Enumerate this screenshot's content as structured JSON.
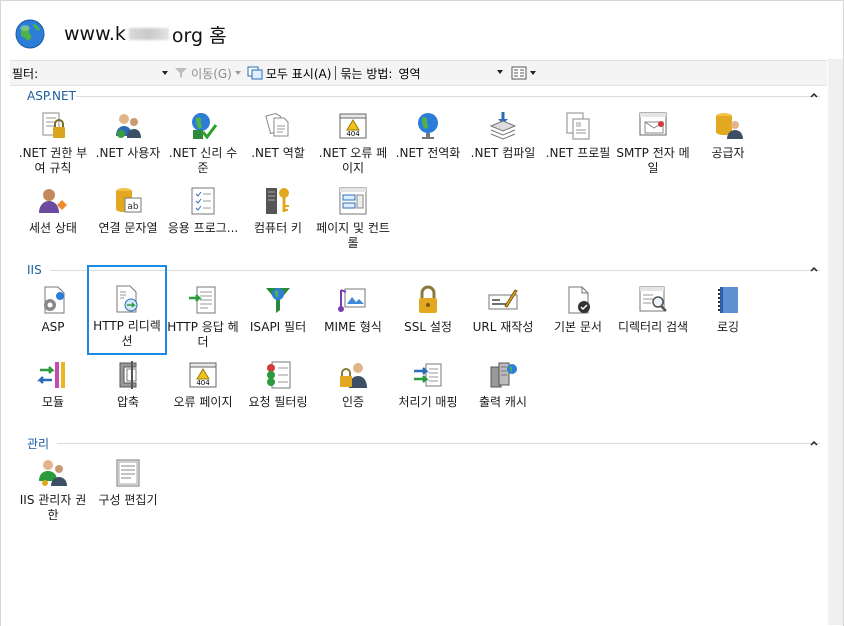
{
  "header": {
    "title_prefix": "www.k",
    "title_suffix": "org 홈",
    "icon": "globe-icon"
  },
  "toolbar": {
    "filter_label": "필터:",
    "filter_value": "",
    "go_label": "이동(G)",
    "show_all_label": "모두 표시(A)",
    "group_by_label": "묶는 방법:",
    "group_by_value": "영역",
    "view_icon": "view-grid-icon"
  },
  "sections": [
    {
      "name": "ASP.NET",
      "items": [
        {
          "label": ".NET 권한 부여 규칙",
          "icon": "lock-doc-icon"
        },
        {
          "label": ".NET 사용자",
          "icon": "users-icon"
        },
        {
          "label": ".NET 신리 수준",
          "icon": "trust-icon"
        },
        {
          "label": ".NET 역할",
          "icon": "roles-icon"
        },
        {
          "label": ".NET 오류 페이지",
          "icon": "error-404-icon"
        },
        {
          "label": ".NET 전역화",
          "icon": "globe-icon"
        },
        {
          "label": ".NET 컴파일",
          "icon": "compile-icon"
        },
        {
          "label": ".NET 프로필",
          "icon": "profile-icon"
        },
        {
          "label": "SMTP 전자 메일",
          "icon": "email-icon"
        },
        {
          "label": "공급자",
          "icon": "provider-icon"
        },
        {
          "label": "세션 상태",
          "icon": "session-icon"
        },
        {
          "label": "연결 문자열",
          "icon": "database-icon"
        },
        {
          "label": "응용 프로그...",
          "icon": "app-settings-icon"
        },
        {
          "label": "컴퓨터 키",
          "icon": "machine-key-icon"
        },
        {
          "label": "페이지 및 컨트롤",
          "icon": "pages-controls-icon"
        }
      ]
    },
    {
      "name": "IIS",
      "items": [
        {
          "label": "ASP",
          "icon": "asp-icon"
        },
        {
          "label": "HTTP 리디렉션",
          "icon": "redirect-icon",
          "selected": true
        },
        {
          "label": "HTTP 응답 헤더",
          "icon": "response-headers-icon"
        },
        {
          "label": "ISAPI 필터",
          "icon": "isapi-filter-icon"
        },
        {
          "label": "MIME 형식",
          "icon": "mime-icon"
        },
        {
          "label": "SSL 설정",
          "icon": "ssl-lock-icon"
        },
        {
          "label": "URL 재작성",
          "icon": "url-rewrite-icon"
        },
        {
          "label": "기본 문서",
          "icon": "default-doc-icon"
        },
        {
          "label": "디렉터리 검색",
          "icon": "dir-browse-icon"
        },
        {
          "label": "로깅",
          "icon": "logging-icon"
        },
        {
          "label": "모듈",
          "icon": "modules-icon"
        },
        {
          "label": "압축",
          "icon": "compression-icon"
        },
        {
          "label": "오류 페이지",
          "icon": "error-pages-icon"
        },
        {
          "label": "요청 필터링",
          "icon": "request-filter-icon"
        },
        {
          "label": "인증",
          "icon": "auth-icon"
        },
        {
          "label": "처리기 매핑",
          "icon": "handler-icon"
        },
        {
          "label": "출력 캐시",
          "icon": "output-cache-icon"
        }
      ]
    },
    {
      "name": "관리",
      "items": [
        {
          "label": "IIS 관리자 권한",
          "icon": "mgr-perm-icon"
        },
        {
          "label": "구성 편집기",
          "icon": "config-editor-icon"
        }
      ]
    }
  ],
  "colors": {
    "accent": "#1b5c9e",
    "selection": "#1e88e5"
  }
}
